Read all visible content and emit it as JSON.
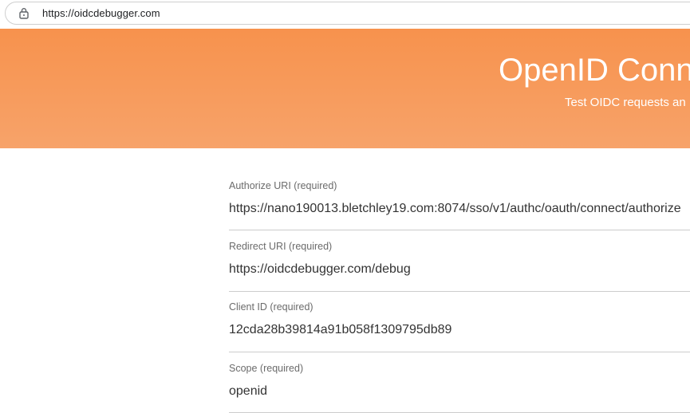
{
  "browser": {
    "url": "https://oidcdebugger.com"
  },
  "hero": {
    "title": "OpenID Conne",
    "subtitle": "Test OIDC requests an"
  },
  "form": {
    "fields": [
      {
        "label": "Authorize URI (required)",
        "value": "https://nano190013.bletchley19.com:8074/sso/v1/authc/oauth/connect/authorize"
      },
      {
        "label": "Redirect URI (required)",
        "value": "https://oidcdebugger.com/debug"
      },
      {
        "label": "Client ID (required)",
        "value": "12cda28b39814a91b058f1309795db89"
      },
      {
        "label": "Scope (required)",
        "value": "openid"
      }
    ]
  },
  "colors": {
    "hero_top": "#f7924d",
    "hero_bottom": "#f7a36a",
    "label": "#6b6b6b",
    "value": "#333333",
    "divider": "#cccccc"
  }
}
